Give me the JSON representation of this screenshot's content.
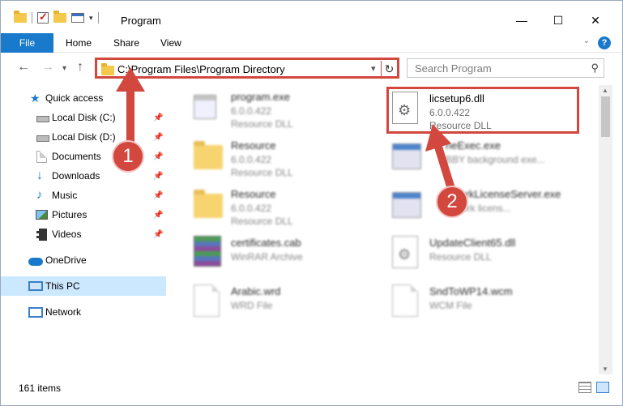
{
  "window": {
    "title": "Program",
    "minimize": "—",
    "maximize": "☐",
    "close": "✕"
  },
  "ribbon": {
    "tabs": [
      "File",
      "Home",
      "Share",
      "View"
    ],
    "help": "?"
  },
  "nav": {
    "address": "C:\\Program Files\\Program Directory",
    "search_placeholder": "Search Program"
  },
  "sidebar": {
    "items": [
      {
        "label": "Quick access",
        "icon": "star-icon"
      },
      {
        "label": "Local Disk (C:)",
        "icon": "disk-icon"
      },
      {
        "label": "Local Disk (D:)",
        "icon": "disk-icon"
      },
      {
        "label": "Documents",
        "icon": "documents-icon"
      },
      {
        "label": "Downloads",
        "icon": "download-icon"
      },
      {
        "label": "Music",
        "icon": "music-icon"
      },
      {
        "label": "Pictures",
        "icon": "pictures-icon"
      },
      {
        "label": "Videos",
        "icon": "videos-icon"
      },
      {
        "label": "OneDrive",
        "icon": "cloud-icon"
      },
      {
        "label": "This PC",
        "icon": "computer-icon",
        "selected": true
      },
      {
        "label": "Network",
        "icon": "network-icon"
      }
    ]
  },
  "files": {
    "left": [
      {
        "name": "program.exe",
        "line1": "6.0.0.422",
        "line2": "Resource DLL",
        "icon": "exe-icon"
      },
      {
        "name": "Resource",
        "line1": "6.0.0.422",
        "line2": "Resource DLL",
        "icon": "folder-icon"
      },
      {
        "name": "Resource",
        "line1": "6.0.0.422",
        "line2": "Resource DLL",
        "icon": "folder-icon"
      },
      {
        "name": "certificates.cab",
        "line1": "WinRAR Archive",
        "line2": "",
        "icon": "archive-icon"
      },
      {
        "name": "Arabic.wrd",
        "line1": "WRD File",
        "line2": "",
        "icon": "document-icon"
      }
    ],
    "right": [
      {
        "name": "licsetup6.dll",
        "line1": "6.0.0.422",
        "line2": "Resource DLL",
        "icon": "dll-icon"
      },
      {
        "name": "neExec.exe",
        "line1": "BBY background exe...",
        "line2": "",
        "icon": "exe-icon"
      },
      {
        "name": "workLicenseServer.exe",
        "line1": "twork licens...",
        "line2": "",
        "icon": "exe-icon"
      },
      {
        "name": "UpdateClient65.dll",
        "line1": "Resource DLL",
        "line2": "",
        "icon": "dll-icon"
      },
      {
        "name": "SndToWP14.wcm",
        "line1": "WCM File",
        "line2": "",
        "icon": "document-icon"
      }
    ]
  },
  "status": {
    "item_count": "161 items"
  },
  "annotations": {
    "marker1": "1",
    "marker2": "2",
    "arrow_color": "#d2473e"
  }
}
